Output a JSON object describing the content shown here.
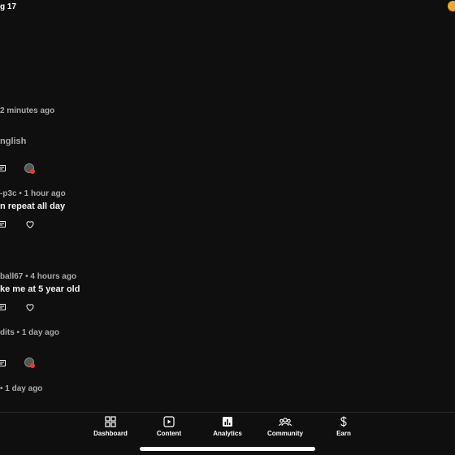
{
  "status": {
    "time": "g 17"
  },
  "comments": [
    {
      "meta": "2 minutes ago",
      "text": "nglish",
      "actions": [
        "reply-icon",
        "avatar-icon"
      ]
    },
    {
      "meta": "-p3c • 1 hour ago",
      "text": "n repeat all day",
      "actions": [
        "reply-icon",
        "heart-icon"
      ]
    },
    {
      "meta": "ball67 • 4 hours ago",
      "text": "ke me at 5 year old",
      "actions": [
        "reply-icon",
        "heart-icon"
      ]
    },
    {
      "meta": "dits • 1 day ago",
      "text": "",
      "actions": [
        "reply-icon",
        "avatar-icon"
      ]
    },
    {
      "meta": "• 1 day ago",
      "text": "",
      "actions": []
    }
  ],
  "nav": {
    "items": [
      {
        "label": "Dashboard",
        "icon": "dashboard-icon"
      },
      {
        "label": "Content",
        "icon": "content-icon"
      },
      {
        "label": "Analytics",
        "icon": "analytics-icon"
      },
      {
        "label": "Community",
        "icon": "community-icon"
      },
      {
        "label": "Earn",
        "icon": "earn-icon"
      }
    ]
  },
  "colors": {
    "background": "#0f0f0f",
    "text": "#f1f1f1",
    "meta": "#aaaaaa",
    "status_dot": "#f5a623",
    "avatar_badge": "#e53935"
  }
}
